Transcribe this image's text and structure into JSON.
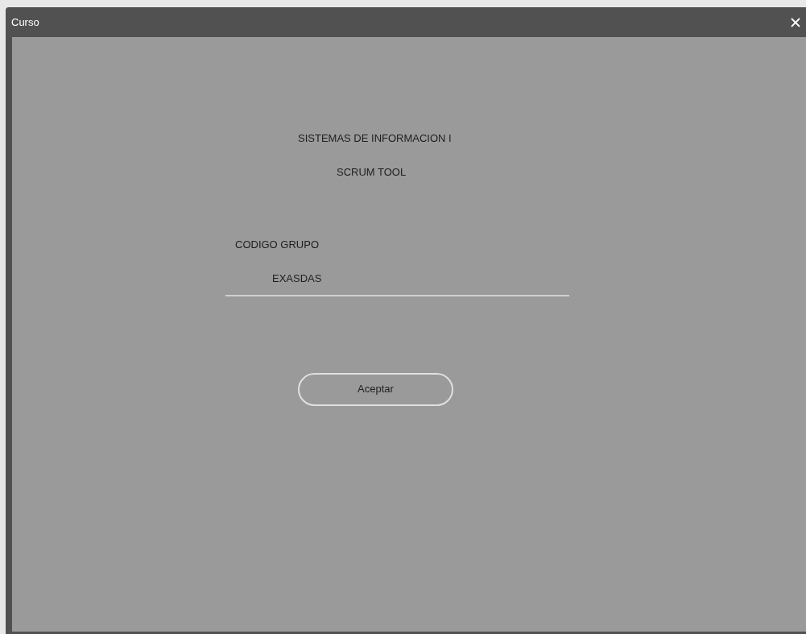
{
  "window": {
    "title": "Curso"
  },
  "headings": [
    "SISTEMAS DE INFORMACION I",
    "SCRUM TOOL"
  ],
  "group_code": {
    "label": "CODIGO GRUPO",
    "value": "EXASDAS"
  },
  "buttons": [
    "Aceptar"
  ]
}
